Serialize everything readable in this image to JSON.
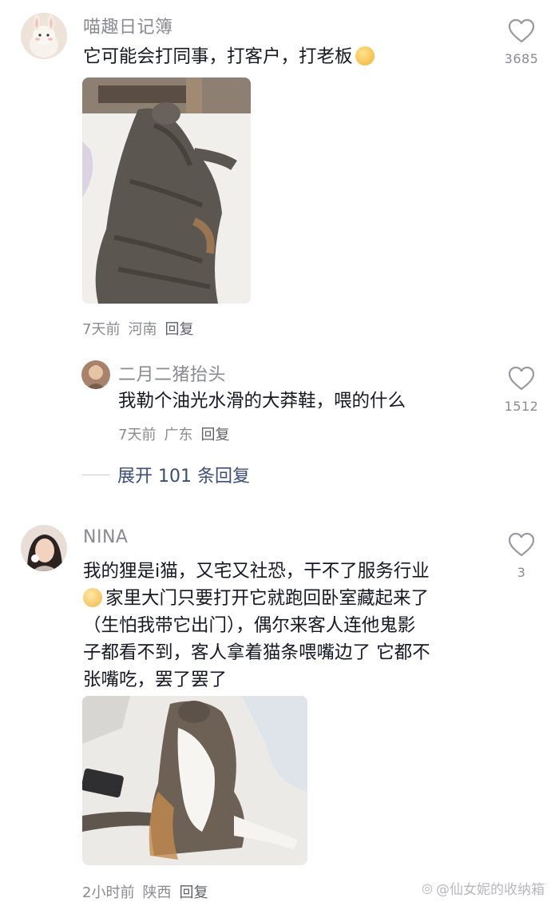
{
  "comments": [
    {
      "username": "喵趣日记簿",
      "text": "它可能会打同事，打客户，打老板",
      "emoji": "smiling-face-emoji",
      "like_count": "3685",
      "time": "7天前",
      "location": "河南",
      "reply_label": "回复",
      "photo_icon": "cat-lying-on-bed-photo"
    },
    {
      "username": "NINA",
      "text_lines": [
        "我的狸是i猫，又宅又社恐，干不了服务行业",
        "家里大门只要打开它就跑回卧室藏起来了",
        "（生怕我带它出门），偶尔来客人连他鬼影",
        "子都看不到，客人拿着猫条喂嘴边了 它都不",
        "张嘴吃，罢了罢了"
      ],
      "emoji": "crying-face-emoji",
      "like_count": "3",
      "time": "2小时前",
      "location": "陕西",
      "reply_label": "回复",
      "photo_icon": "cat-sitting-on-bed-photo"
    }
  ],
  "reply": {
    "username": "二月二猪抬头",
    "text": "我勒个油光水滑的大莽鞋，喂的什么",
    "like_count": "1512",
    "time": "7天前",
    "location": "广东",
    "reply_label": "回复"
  },
  "expand_label": "展开 101 条回复",
  "watermark": "@仙女妮的收纳箱",
  "colors": {
    "text": "#161823",
    "muted": "#8a8b91",
    "link": "#3b4d7a"
  }
}
